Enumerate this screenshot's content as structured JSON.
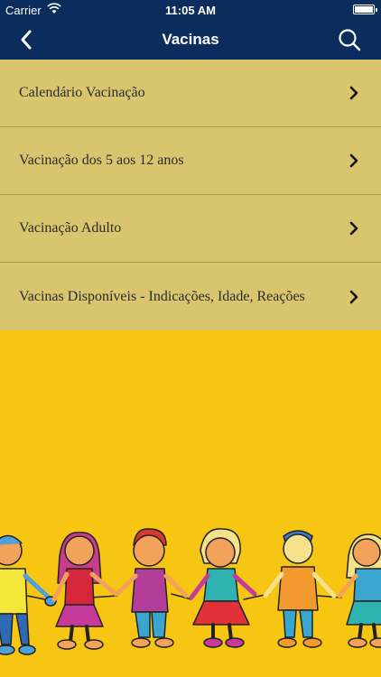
{
  "status_bar": {
    "carrier": "Carrier",
    "time": "11:05 AM"
  },
  "nav": {
    "title": "Vacinas",
    "back_icon": "chevron-left-icon",
    "search_icon": "search-icon"
  },
  "menu": {
    "items": [
      {
        "label": "Calendário Vacinação"
      },
      {
        "label": "Vacinação dos 5 aos 12 anos"
      },
      {
        "label": "Vacinação Adulto"
      },
      {
        "label": "Vacinas Disponíveis - Indicações, Idade, Reações"
      }
    ]
  },
  "colors": {
    "nav_background": "#0a2d5e",
    "list_background": "#d9c56e",
    "page_background": "#f7c613"
  }
}
